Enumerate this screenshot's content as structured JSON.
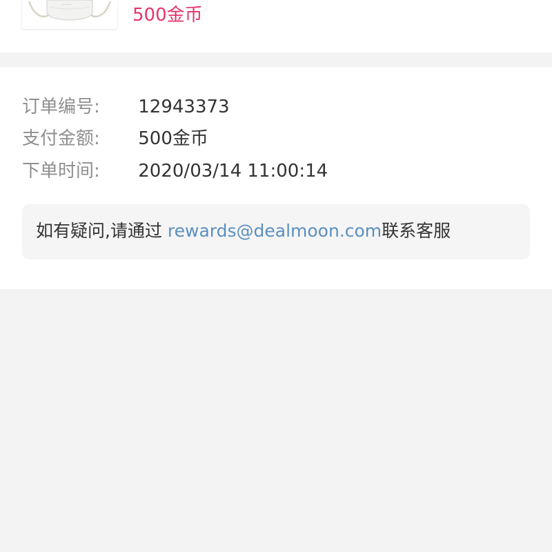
{
  "product": {
    "image_icon": "mask-product-image",
    "price": "500金币",
    "price_color": "#e6336a"
  },
  "order": {
    "rows": [
      {
        "label": "订单编号:",
        "value": "12943373"
      },
      {
        "label": "支付金额:",
        "value": "500金币"
      },
      {
        "label": "下单时间:",
        "value": "2020/03/14 11:00:14"
      }
    ]
  },
  "help": {
    "prefix": "如有疑问,请通过 ",
    "email": "rewards@dealmoon.com",
    "suffix": "联系客服",
    "link_color": "#5b8fc0"
  }
}
